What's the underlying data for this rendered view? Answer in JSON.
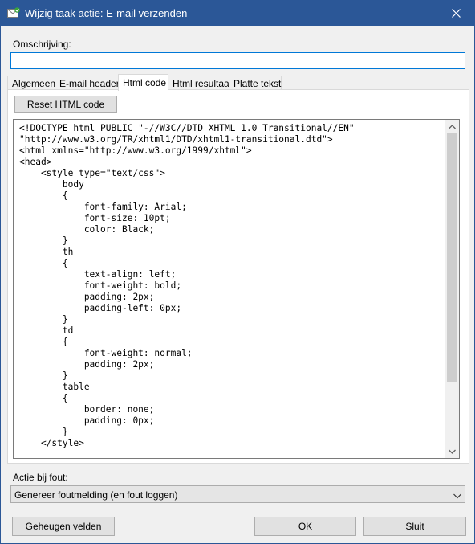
{
  "window": {
    "title": "Wijzig taak actie: E-mail verzenden",
    "icon": "email-task-icon",
    "accent_color": "#2b5797"
  },
  "description": {
    "label": "Omschrijving:",
    "value": ""
  },
  "tabs": [
    {
      "label": "Algemeen",
      "active": false
    },
    {
      "label": "E-mail headers",
      "active": false
    },
    {
      "label": "Html code",
      "active": true
    },
    {
      "label": "Html resultaat",
      "active": false
    },
    {
      "label": "Platte tekst",
      "active": false
    }
  ],
  "html_tab": {
    "reset_button": "Reset HTML code",
    "code": "<!DOCTYPE html PUBLIC \"-//W3C//DTD XHTML 1.0 Transitional//EN\"\n\"http://www.w3.org/TR/xhtml1/DTD/xhtml1-transitional.dtd\">\n<html xmlns=\"http://www.w3.org/1999/xhtml\">\n<head>\n    <style type=\"text/css\">\n        body\n        {\n            font-family: Arial;\n            font-size: 10pt;\n            color: Black;\n        }\n        th\n        {\n            text-align: left;\n            font-weight: bold;\n            padding: 2px;\n            padding-left: 0px;\n        }\n        td\n        {\n            font-weight: normal;\n            padding: 2px;\n        }\n        table\n        {\n            border: none;\n            padding: 0px;\n        }\n    </style>"
  },
  "error_action": {
    "label": "Actie bij fout:",
    "selected": "Genereer foutmelding (en fout loggen)"
  },
  "footer": {
    "memory_fields_button": "Geheugen velden",
    "ok_button": "OK",
    "close_button": "Sluit"
  }
}
